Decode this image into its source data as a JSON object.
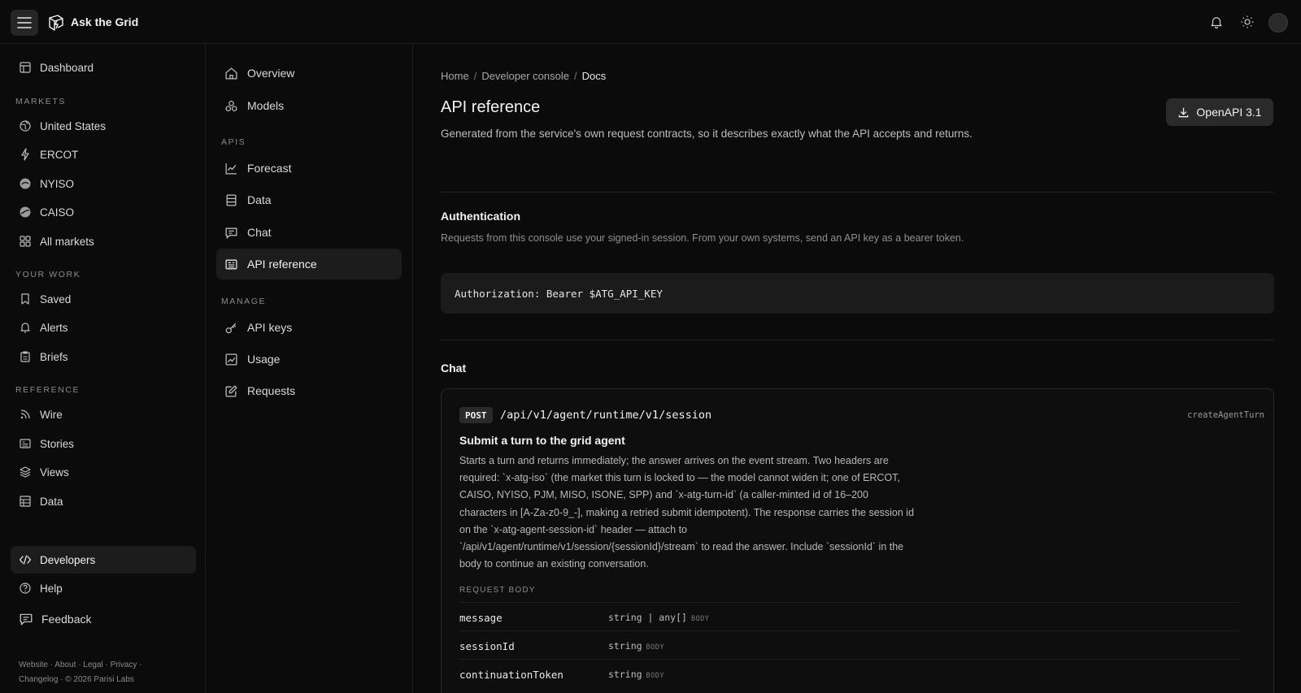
{
  "app": {
    "brand": "Ask the Grid"
  },
  "sidebar": {
    "dashboard": "Dashboard",
    "markets_label": "MARKETS",
    "markets": [
      "United States",
      "ERCOT",
      "NYISO",
      "CAISO",
      "All markets"
    ],
    "your_work_label": "YOUR WORK",
    "your_work": [
      "Saved",
      "Alerts",
      "Briefs"
    ],
    "reference_label": "REFERENCE",
    "reference": [
      "Wire",
      "Stories",
      "Views",
      "Data"
    ],
    "developers": "Developers",
    "help": "Help",
    "feedback": "Feedback",
    "footer_line1": "Website · About · Legal · Privacy ·",
    "footer_line2": "Changelog · © 2026 Parisi Labs"
  },
  "subnav": {
    "overview": "Overview",
    "models": "Models",
    "apis_label": "APIS",
    "forecast": "Forecast",
    "data": "Data",
    "chat": "Chat",
    "api_reference": "API reference",
    "manage_label": "MANAGE",
    "api_keys": "API keys",
    "usage": "Usage",
    "requests": "Requests"
  },
  "breadcrumb": [
    "Home",
    "Developer console",
    "Docs"
  ],
  "page": {
    "title": "API reference",
    "subtitle": "Generated from the service's own request contracts, so it describes exactly what the API accepts and returns.",
    "openapi_button": "OpenAPI 3.1"
  },
  "auth": {
    "title": "Authentication",
    "text": "Requests from this console use your signed-in session. From your own systems, send an API key as a bearer token.",
    "code": "Authorization: Bearer $ATG_API_KEY"
  },
  "chat_section": {
    "title": "Chat",
    "endpoint": {
      "method": "POST",
      "path": "/api/v1/agent/runtime/v1/session",
      "operation_id": "createAgentTurn",
      "summary": "Submit a turn to the grid agent",
      "description": "Starts a turn and returns immediately; the answer arrives on the event stream. Two headers are required: `x-atg-iso` (the market this turn is locked to — the model cannot widen it; one of ERCOT, CAISO, NYISO, PJM, MISO, ISONE, SPP) and `x-atg-turn-id` (a caller-minted id of 16–200 characters in [A-Za-z0-9_-], making a retried submit idempotent). The response carries the session id on the `x-atg-agent-session-id` header — attach to `/api/v1/agent/runtime/v1/session/{sessionId}/stream` to read the answer. Include `sessionId` in the body to continue an existing conversation.",
      "request_body_label": "REQUEST BODY",
      "fields": [
        {
          "name": "message",
          "type": "string | any[]",
          "location": "BODY"
        },
        {
          "name": "sessionId",
          "type": "string",
          "location": "BODY"
        },
        {
          "name": "continuationToken",
          "type": "string",
          "location": "BODY"
        }
      ]
    }
  }
}
